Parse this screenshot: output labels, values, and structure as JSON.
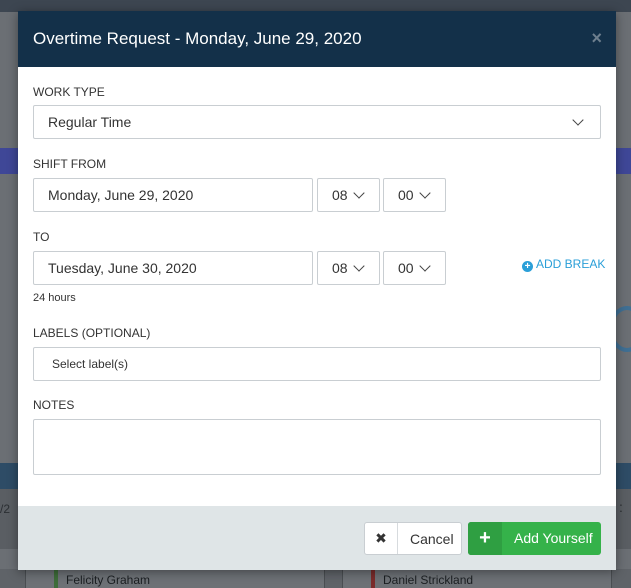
{
  "background": {
    "left_fragment": "/2",
    "right_fragment": ":",
    "card_left_name": "Felicity Graham",
    "card_right_name": "Daniel Strickland"
  },
  "modal": {
    "title": "Overtime Request - Monday, June 29, 2020",
    "close_glyph": "×",
    "work_type": {
      "label": "WORK TYPE",
      "value": "Regular Time"
    },
    "shift_from": {
      "label": "SHIFT FROM",
      "date": "Monday, June 29, 2020",
      "hour": "08",
      "minute": "00"
    },
    "to": {
      "label": "TO",
      "date": "Tuesday, June 30, 2020",
      "hour": "08",
      "minute": "00"
    },
    "add_break": {
      "icon": "plus-circle-icon",
      "label": "ADD BREAK"
    },
    "duration": "24 hours",
    "labels": {
      "label": "LABELS (OPTIONAL)",
      "placeholder": "Select label(s)"
    },
    "notes": {
      "label": "NOTES",
      "value": ""
    },
    "footer": {
      "cancel": {
        "icon": "x-icon",
        "glyph": "✖",
        "label": "Cancel"
      },
      "add": {
        "icon": "plus-icon",
        "glyph": "+",
        "label": "Add Yourself"
      }
    }
  },
  "colors": {
    "header": "#133049",
    "accent": "#2a9fd8",
    "primary_button": "#35b24a",
    "footer": "#dfe5e7"
  }
}
